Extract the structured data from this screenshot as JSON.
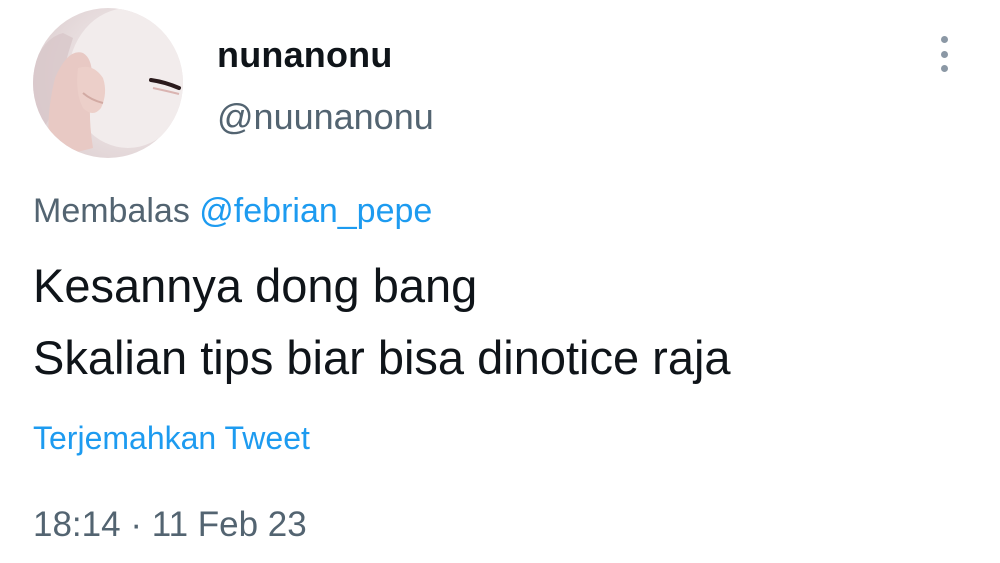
{
  "tweet": {
    "display_name": "nunanonu",
    "handle": "@nuunanonu",
    "reply_prefix": "Membalas",
    "reply_mention": "@febrian_pepe",
    "text_lines": [
      "Kesannya dong bang",
      "Skalian tips biar bisa dinotice raja"
    ],
    "translate_label": "Terjemahkan Tweet",
    "time": "18:14",
    "separator": "·",
    "date": "11 Feb 23"
  },
  "icons": {
    "more": "more-vertical-icon",
    "avatar": "profile-avatar-image"
  },
  "colors": {
    "link": "#1d9bf0",
    "secondary_text": "#536471",
    "primary_text": "#0f1419",
    "background": "#ffffff"
  }
}
